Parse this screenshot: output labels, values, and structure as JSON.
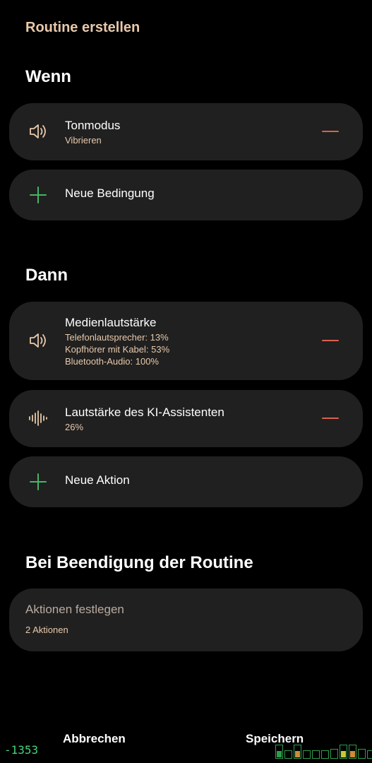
{
  "header": {
    "title": "Routine erstellen"
  },
  "if_section": {
    "heading": "Wenn",
    "conditions": [
      {
        "icon": "speaker-icon",
        "label": "Tonmodus",
        "sub": "Vibrieren"
      }
    ],
    "add_label": "Neue Bedingung"
  },
  "then_section": {
    "heading": "Dann",
    "actions": [
      {
        "icon": "speaker-icon",
        "label": "Medienlautstärke",
        "sub_lines": [
          "Telefonlautsprecher: 13%",
          "Kopfhörer mit Kabel: 53%",
          "Bluetooth-Audio: 100%"
        ]
      },
      {
        "icon": "waveform-icon",
        "label": "Lautstärke des KI-Assistenten",
        "sub": "26%"
      }
    ],
    "add_label": "Neue Aktion"
  },
  "end_section": {
    "heading": "Bei Beendigung der Routine",
    "card_label": "Aktionen festlegen",
    "card_sub": "2 Aktionen"
  },
  "footer": {
    "cancel_label": "Abbrechen",
    "save_label": "Speichern"
  },
  "debug_overlay": {
    "counter": "-1353",
    "meter_levels": [
      0.5,
      0.0,
      0.5,
      0.0,
      0.0,
      0.0,
      0.0,
      0.5,
      0.5,
      0.0,
      0.0
    ],
    "meter_colors": [
      "#2f9c4c",
      "#2f9c4c",
      "#d08a3a",
      "#2f9c4c",
      "#2f9c4c",
      "#2f9c4c",
      "#2f9c4c",
      "#d0c43a",
      "#d08a3a",
      "#2f9c4c",
      "#2f9c4c"
    ]
  },
  "colors": {
    "accent": "#e8c9ab",
    "remove": "#d9624d",
    "add": "#47b565",
    "card_bg": "#202020"
  }
}
